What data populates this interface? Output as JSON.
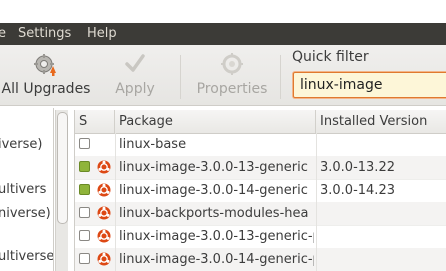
{
  "menubar": {
    "items": [
      "e",
      "Settings",
      "Help"
    ]
  },
  "toolbar": {
    "all_upgrades_label": "All Upgrades",
    "apply_label": "Apply",
    "properties_label": "Properties",
    "quick_filter_label": "Quick filter",
    "quick_filter_value": "linux-image"
  },
  "sidebar": {
    "items": [
      "iverse)",
      "ultivers",
      "niverse)",
      "",
      "ultiverse"
    ]
  },
  "table": {
    "headers": [
      "S",
      "Package",
      "Installed Version"
    ],
    "rows": [
      {
        "status": "not-installed",
        "supported": false,
        "package": "linux-base",
        "installed_version": ""
      },
      {
        "status": "installed",
        "supported": true,
        "package": "linux-image-3.0.0-13-generic",
        "installed_version": "3.0.0-13.22"
      },
      {
        "status": "installed",
        "supported": true,
        "package": "linux-image-3.0.0-14-generic",
        "installed_version": "3.0.0-14.23"
      },
      {
        "status": "not-installed",
        "supported": true,
        "package": "linux-backports-modules-hea",
        "installed_version": ""
      },
      {
        "status": "not-installed",
        "supported": true,
        "package": "linux-image-3.0.0-13-generic-p",
        "installed_version": ""
      },
      {
        "status": "not-installed",
        "supported": true,
        "package": "linux-image-3.0.0-14-generic-p",
        "installed_version": ""
      }
    ]
  },
  "colors": {
    "menubar_bg": "#3c3b37",
    "installed_green": "#8fb43a",
    "ubuntu_red": "#dd4814",
    "filter_border": "#e0792f"
  }
}
